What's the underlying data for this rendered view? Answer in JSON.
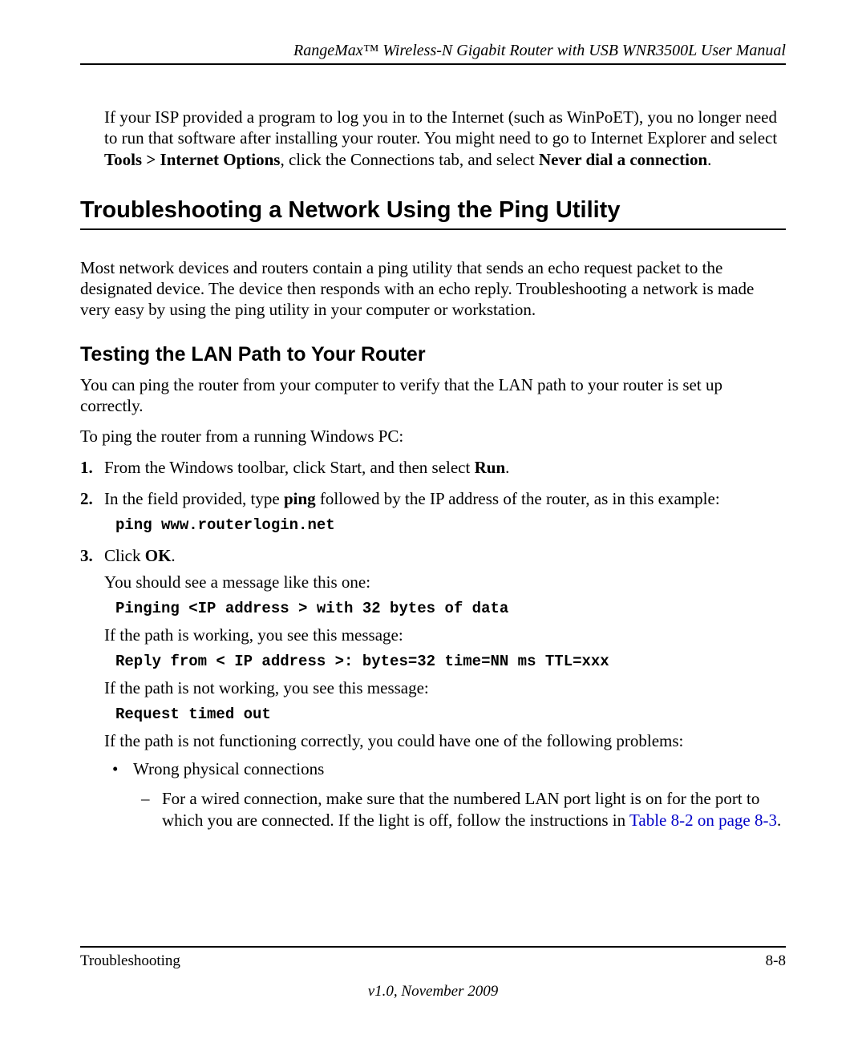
{
  "header": {
    "title": "RangeMax™ Wireless-N Gigabit Router with USB WNR3500L User Manual"
  },
  "intro": {
    "seg1": "If your ISP provided a program to log you in to the Internet (such as WinPoET), you no longer need to run that software after installing your router. You might need to go to Internet Explorer and select ",
    "bold1": "Tools > Internet Options",
    "seg2": ", click the Connections tab, and select ",
    "bold2": "Never dial a connection",
    "seg3": "."
  },
  "h1": "Troubleshooting a Network Using the Ping Utility",
  "section_para": "Most network devices and routers contain a ping utility that sends an echo request packet to the designated device. The device then responds with an echo reply. Troubleshooting a network is made very easy by using the ping utility in your computer or workstation.",
  "h2": "Testing the LAN Path to Your Router",
  "para1": "You can ping the router from your computer to verify that the LAN path to your router is set up correctly.",
  "para2": "To ping the router from a running Windows PC:",
  "steps": {
    "s1": {
      "num": "1.",
      "seg1": "From the Windows toolbar, click Start, and then select ",
      "bold1": "Run",
      "seg2": "."
    },
    "s2": {
      "num": "2.",
      "seg1": "In the field provided, type ",
      "bold1": "ping",
      "seg2": " followed by the IP address of the router, as in this example:",
      "code": "ping www.routerlogin.net"
    },
    "s3": {
      "num": "3.",
      "seg1": "Click ",
      "bold1": "OK",
      "seg2": ".",
      "sub1": "You should see a message like this one:",
      "code1": "Pinging <IP address > with 32 bytes of data",
      "sub2": "If the path is working, you see this message:",
      "code2": "Reply from < IP address >: bytes=32 time=NN ms TTL=xxx",
      "sub3": "If the path is not working, you see this message:",
      "code3": "Request timed out",
      "sub4": "If the path is not functioning correctly, you could have one of the following problems:",
      "bullet1": "Wrong physical connections",
      "dash1_seg1": "For a wired connection, make sure that the numbered LAN port light is on for the port to which you are connected. If the light is off, follow the instructions in ",
      "dash1_link": "Table 8-2 on page 8-3",
      "dash1_seg2": "."
    }
  },
  "footer": {
    "left": "Troubleshooting",
    "right": "8-8",
    "version": "v1.0, November 2009"
  }
}
